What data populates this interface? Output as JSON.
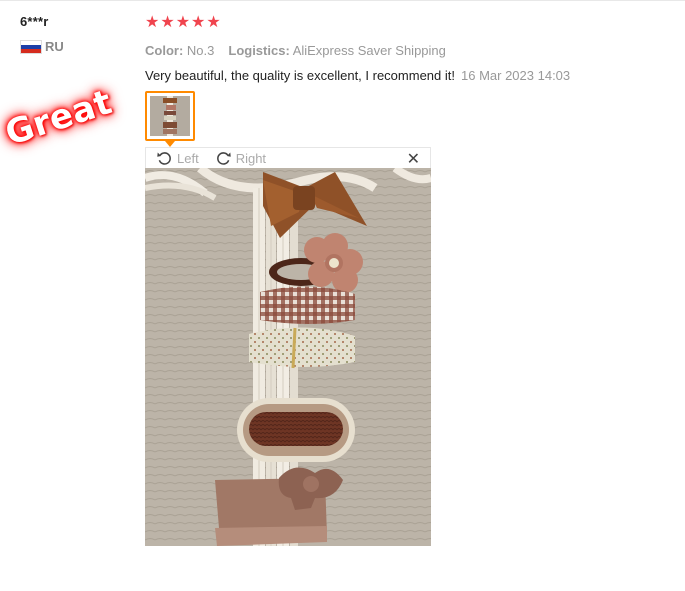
{
  "user": {
    "name": "6***r",
    "country": "RU"
  },
  "stamp": {
    "text": "Great"
  },
  "review": {
    "rating": 5,
    "color_label": "Color:",
    "color_value": "No.3",
    "logistics_label": "Logistics:",
    "logistics_value": "AliExpress Saver Shipping",
    "text": "Very beautiful, the quality is excellent, I recommend it!",
    "date": "16 Mar 2023 14:03"
  },
  "viewer": {
    "left_label": "Left",
    "right_label": "Right",
    "close_symbol": "✕",
    "rotate_left_icon": "rotate-left-icon",
    "rotate_right_icon": "rotate-right-icon"
  },
  "colors": {
    "star": "#f0444e",
    "thumb_border": "#ff8a00",
    "stamp_glow": "#ff0000"
  }
}
